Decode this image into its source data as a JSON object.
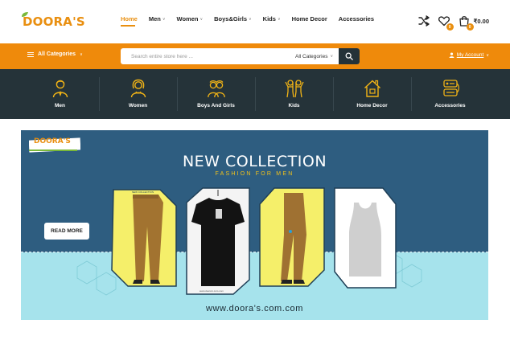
{
  "brand": {
    "logo_text": "DOORA'S"
  },
  "nav": {
    "items": [
      {
        "label": "Home",
        "active": true,
        "has_dropdown": false
      },
      {
        "label": "Men",
        "active": false,
        "has_dropdown": true
      },
      {
        "label": "Women",
        "active": false,
        "has_dropdown": true
      },
      {
        "label": "Boys&Girls",
        "active": false,
        "has_dropdown": true
      },
      {
        "label": "Kids",
        "active": false,
        "has_dropdown": true
      },
      {
        "label": "Home Decor",
        "active": false,
        "has_dropdown": false
      },
      {
        "label": "Accessories",
        "active": false,
        "has_dropdown": false
      }
    ]
  },
  "header_icons": {
    "compare_icon": "shuffle-icon",
    "wishlist_icon": "heart-icon",
    "wishlist_count": "0",
    "cart_icon": "shopping-bag-icon",
    "cart_count": "0",
    "cart_total": "₹0.00"
  },
  "searchbar": {
    "all_categories": "All Categories",
    "placeholder": "Search entire store here ...",
    "category_select": "All Categories",
    "search_icon": "search-icon",
    "account_label": "My Account"
  },
  "categories": [
    {
      "label": "Men",
      "icon": "man-icon"
    },
    {
      "label": "Women",
      "icon": "woman-icon"
    },
    {
      "label": "Boys And Girls",
      "icon": "boys-and-girls-icon"
    },
    {
      "label": "Kids",
      "icon": "kids-icon"
    },
    {
      "label": "Home Decor",
      "icon": "house-icon"
    },
    {
      "label": "Accessories",
      "icon": "accessories-icon"
    }
  ],
  "banner": {
    "logo_text": "DOORA'S",
    "title": "NEW COLLECTION",
    "subtitle": "FASHION FOR MEN",
    "card_tag": "NEW COLLECTION",
    "button_label": "READ MORE",
    "url": "www.doora's.com.com",
    "colors": {
      "upper": "#2e5d80",
      "lower": "#a6e3ec",
      "accent": "#f2c21a",
      "card_yellow": "#f5ef6a"
    }
  },
  "colors": {
    "orange": "#ef8a0b",
    "dark": "#253339",
    "accent_text": "#e98f10"
  }
}
